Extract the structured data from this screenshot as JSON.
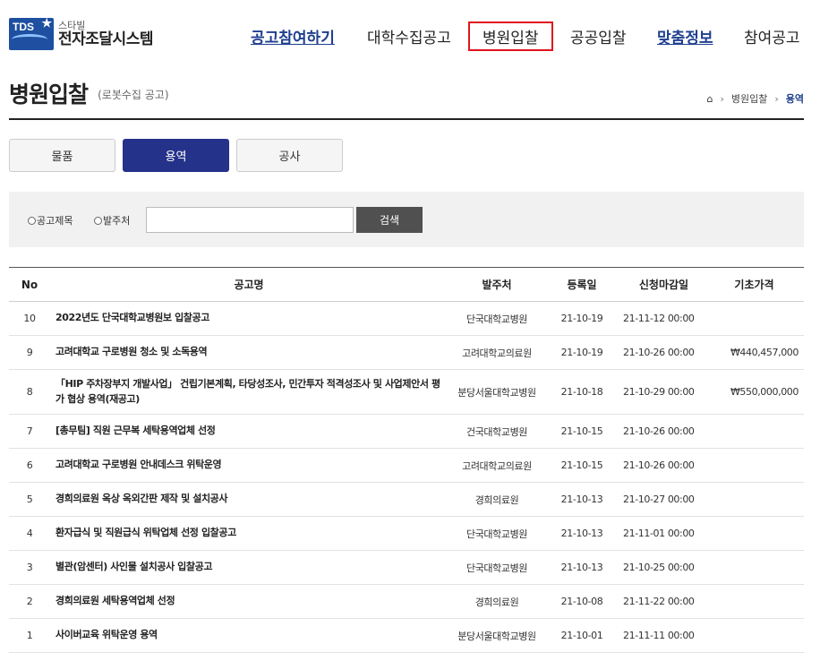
{
  "header": {
    "logo_abbr": "TDS",
    "logo_sub": "스타빌",
    "logo_main": "전자조달시스템",
    "nav": [
      {
        "label": "공고참여하기"
      },
      {
        "label": "대학수집공고"
      },
      {
        "label": "병원입찰"
      },
      {
        "label": "공공입찰"
      },
      {
        "label": "맞춤정보"
      },
      {
        "label": "참여공고"
      }
    ]
  },
  "page": {
    "title": "병원입찰",
    "subtitle": "(로봇수집 공고)"
  },
  "breadcrumb": {
    "home_icon": "home-icon",
    "items": [
      "병원입찰",
      "용역"
    ],
    "separator": "›"
  },
  "tabs": [
    {
      "label": "물품"
    },
    {
      "label": "용역"
    },
    {
      "label": "공사"
    }
  ],
  "search": {
    "options": [
      {
        "label": "공고제목"
      },
      {
        "label": "발주처"
      }
    ],
    "input_value": "",
    "button_label": "검색"
  },
  "table": {
    "headers": [
      "No",
      "공고명",
      "발주처",
      "등록일",
      "신청마감일",
      "기초가격"
    ],
    "rows": [
      {
        "no": "10",
        "title": "2022년도 단국대학교병원보 입찰공고",
        "org": "단국대학교병원",
        "reg": "21-10-19",
        "due": "21-11-12 00:00",
        "price": ""
      },
      {
        "no": "9",
        "title": "고려대학교 구로병원 청소 및 소독용역",
        "org": "고려대학교의료원",
        "reg": "21-10-19",
        "due": "21-10-26 00:00",
        "price": "₩440,457,000"
      },
      {
        "no": "8",
        "title": "「HIP 주차장부지 개발사업」 건립기본계획, 타당성조사, 민간투자 적격성조사 및 사업제안서 평가 협상 용역(재공고)",
        "org": "분당서울대학교병원",
        "reg": "21-10-18",
        "due": "21-10-29 00:00",
        "price": "₩550,000,000"
      },
      {
        "no": "7",
        "title": "[총무팀] 직원 근무복 세탁용역업체 선정",
        "org": "건국대학교병원",
        "reg": "21-10-15",
        "due": "21-10-26 00:00",
        "price": ""
      },
      {
        "no": "6",
        "title": "고려대학교 구로병원 안내데스크 위탁운영",
        "org": "고려대학교의료원",
        "reg": "21-10-15",
        "due": "21-10-26 00:00",
        "price": ""
      },
      {
        "no": "5",
        "title": "경희의료원 옥상 옥외간판 제작 및 설치공사",
        "org": "경희의료원",
        "reg": "21-10-13",
        "due": "21-10-27 00:00",
        "price": ""
      },
      {
        "no": "4",
        "title": "환자급식 및 직원급식 위탁업체 선정 입찰공고",
        "org": "단국대학교병원",
        "reg": "21-10-13",
        "due": "21-11-01 00:00",
        "price": ""
      },
      {
        "no": "3",
        "title": "별관(암센터) 사인물 설치공사 입찰공고",
        "org": "단국대학교병원",
        "reg": "21-10-13",
        "due": "21-10-25 00:00",
        "price": ""
      },
      {
        "no": "2",
        "title": "경희의료원 세탁용역업체 선정",
        "org": "경희의료원",
        "reg": "21-10-08",
        "due": "21-11-22 00:00",
        "price": ""
      },
      {
        "no": "1",
        "title": "사이버교육 위탁운영 용역",
        "org": "분당서울대학교병원",
        "reg": "21-10-01",
        "due": "21-11-11 00:00",
        "price": ""
      }
    ]
  },
  "colors": {
    "brand_blue": "#1e4fa0",
    "active_tab": "#25328a",
    "highlight_border": "#e0141e",
    "search_button": "#505050"
  }
}
